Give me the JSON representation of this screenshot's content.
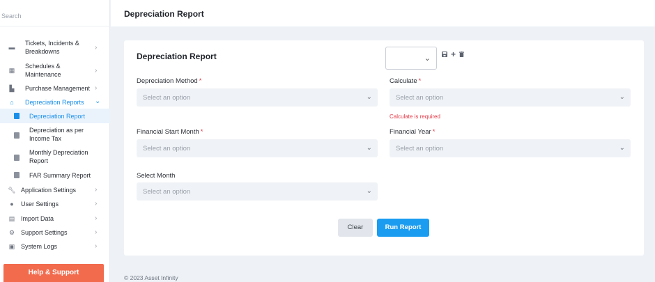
{
  "sidebar": {
    "search_placeholder": "Search",
    "items": [
      {
        "label": "Tickets, Incidents & Breakdowns",
        "icon": "ticket-icon"
      },
      {
        "label": "Schedules & Maintenance",
        "icon": "calendar-icon"
      },
      {
        "label": "Purchase Management",
        "icon": "building-icon"
      },
      {
        "label": "Depreciation Reports",
        "icon": "home-icon"
      },
      {
        "label": "Application Settings",
        "icon": "wrench-icon"
      },
      {
        "label": "User Settings",
        "icon": "users-icon"
      },
      {
        "label": "Import Data",
        "icon": "import-icon"
      },
      {
        "label": "Support Settings",
        "icon": "gears-icon"
      },
      {
        "label": "System Logs",
        "icon": "clipboard-icon"
      }
    ],
    "sub_items": [
      {
        "label": "Depreciation Report"
      },
      {
        "label": "Depreciation as per Income Tax"
      },
      {
        "label": "Monthly Depreciation Report"
      },
      {
        "label": "FAR Summary Report"
      }
    ],
    "help_label": "Help & Support"
  },
  "header": {
    "title": "Depreciation Report"
  },
  "form": {
    "title": "Depreciation Report",
    "fields": {
      "method": {
        "label": "Depreciation Method",
        "placeholder": "Select an option"
      },
      "calculate": {
        "label": "Calculate",
        "placeholder": "Select an option",
        "error": "Calculate is required"
      },
      "fin_start": {
        "label": "Financial Start Month",
        "placeholder": "Select an option"
      },
      "fin_year": {
        "label": "Financial Year",
        "placeholder": "Select an option"
      },
      "month": {
        "label": "Select Month",
        "placeholder": "Select an option"
      }
    },
    "required_mark": "*",
    "clear_label": "Clear",
    "run_label": "Run Report"
  },
  "footer": {
    "text": "© 2023  Asset Infinity"
  },
  "colors": {
    "accent": "#1a9cf0",
    "help": "#f26b4d",
    "error": "#e53946"
  }
}
